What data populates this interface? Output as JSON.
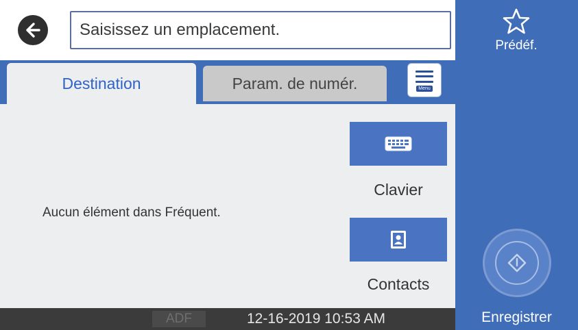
{
  "header": {
    "back_icon": "arrow-left-icon",
    "location_placeholder": "Saisissez un emplacement."
  },
  "tabs": [
    {
      "label": "Destination",
      "active": true
    },
    {
      "label": "Param. de numér.",
      "active": false
    }
  ],
  "menu": {
    "label": "Menu",
    "icon": "menu-icon"
  },
  "content": {
    "empty_message": "Aucun élément dans Fréquent.",
    "keyboard_label": "Clavier",
    "keyboard_icon": "keyboard-icon",
    "contacts_label": "Contacts",
    "contacts_icon": "contacts-icon"
  },
  "status": {
    "source": "ADF",
    "datetime": "12-16-2019 10:53 AM"
  },
  "side": {
    "presets_label": "Prédéf.",
    "presets_icon": "star-icon",
    "start_icon": "start-diamond-icon",
    "save_label": "Enregistrer"
  },
  "colors": {
    "accent_blue": "#3f6db8",
    "button_blue": "#4a73c2",
    "active_tab_text": "#2f63c8",
    "status_bar": "#3b3b3b"
  }
}
